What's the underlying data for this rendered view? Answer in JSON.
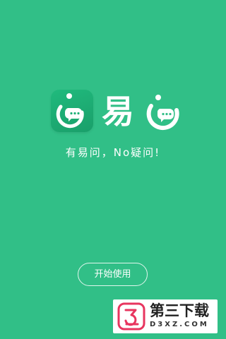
{
  "brand": {
    "name": "易",
    "icon": "chat-bubble-logo-icon"
  },
  "slogan": "有易问，No疑问!",
  "start_button": {
    "label": "开始使用"
  },
  "watermark": {
    "title": "第三下载",
    "subtitle": "D3XZ.COM",
    "icon": "download-logo-icon"
  },
  "colors": {
    "background": "#31bf87",
    "icon_bg": "#1fb178",
    "text": "#ffffff",
    "watermark_accent": "#e8355f"
  }
}
